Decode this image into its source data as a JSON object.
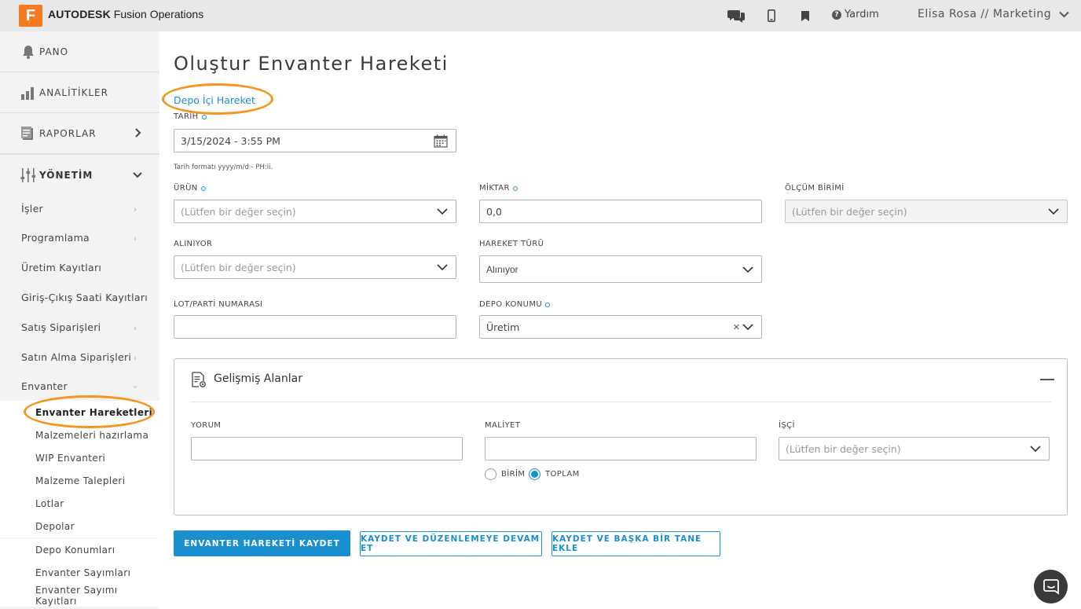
{
  "topbar": {
    "logo_letter": "F",
    "brand_bold": "AUTODESK",
    "brand_rest": " Fusion Operations",
    "help_label": "Yardım",
    "user_label": "Elisa Rosa // Marketing",
    "icons": [
      "chat-icon",
      "mobile-icon",
      "bookmark-icon",
      "help-icon",
      "chevron-down-icon"
    ]
  },
  "sidebar": {
    "main": [
      {
        "label": "PANO",
        "icon": "bell-icon"
      },
      {
        "label": "ANALİTİKLER",
        "icon": "bar-chart-icon"
      },
      {
        "label": "RAPORLAR",
        "icon": "report-icon"
      },
      {
        "label": "YÖNETİM",
        "icon": "sliders-icon"
      }
    ],
    "sub": [
      "İşler",
      "Programlama",
      "Üretim Kayıtları",
      "Giriş-Çıkış Saati Kayıtları",
      "Satış Siparişleri",
      "Satın Alma Siparişleri",
      "Envanter"
    ],
    "leaves": [
      "Envanter Hareketleri",
      "Malzemeleri hazırlama",
      "WIP Envanteri",
      "Malzeme Talepleri",
      "Lotlar",
      "Depolar",
      "Depo Konumları",
      "Envanter Sayımları",
      "Envanter Sayımı Kayıtları"
    ]
  },
  "page": {
    "title": "Oluştur Envanter Hareketi",
    "crumb": "Depo İçi Hareket"
  },
  "form": {
    "tarih_label": "TARİH",
    "tarih_value": "3/15/2024 - 3:55 PM",
    "tarih_hint": "Tarih formatı yyyy/m/d - PH:ii.",
    "urun_label": "ÜRÜN",
    "placeholder": "(Lütfen bir değer seçin)",
    "miktar_label": "MİKTAR",
    "miktar_value": "0,0",
    "olcum_label": "ÖLÇÜM BİRİMİ",
    "aliniyor_label": "ALINIYOR",
    "hareket_label": "HAREKET TÜRÜ",
    "hareket_value": "Alınıyor",
    "lot_label": "LOT/PARTİ NUMARASI",
    "depo_label": "DEPO KONUMU",
    "depo_value": "Üretim"
  },
  "advanced": {
    "title": "Gelişmiş Alanlar",
    "yorum_label": "YORUM",
    "maliyet_label": "MALİYET",
    "isci_label": "İŞÇİ",
    "radio_birim": "BİRİM",
    "radio_toplam": "TOPLAM",
    "selected_radio": "TOPLAM"
  },
  "buttons": {
    "save": "ENVANTER HAREKETİ KAYDET",
    "save_continue": "KAYDET VE DÜZENLEMEYE DEVAM ET",
    "save_another": "KAYDET VE BAŞKA BİR TANE EKLE"
  },
  "colors": {
    "accent": "#1a8fd0",
    "highlight": "#f7931e",
    "brand": "#f47b20"
  }
}
